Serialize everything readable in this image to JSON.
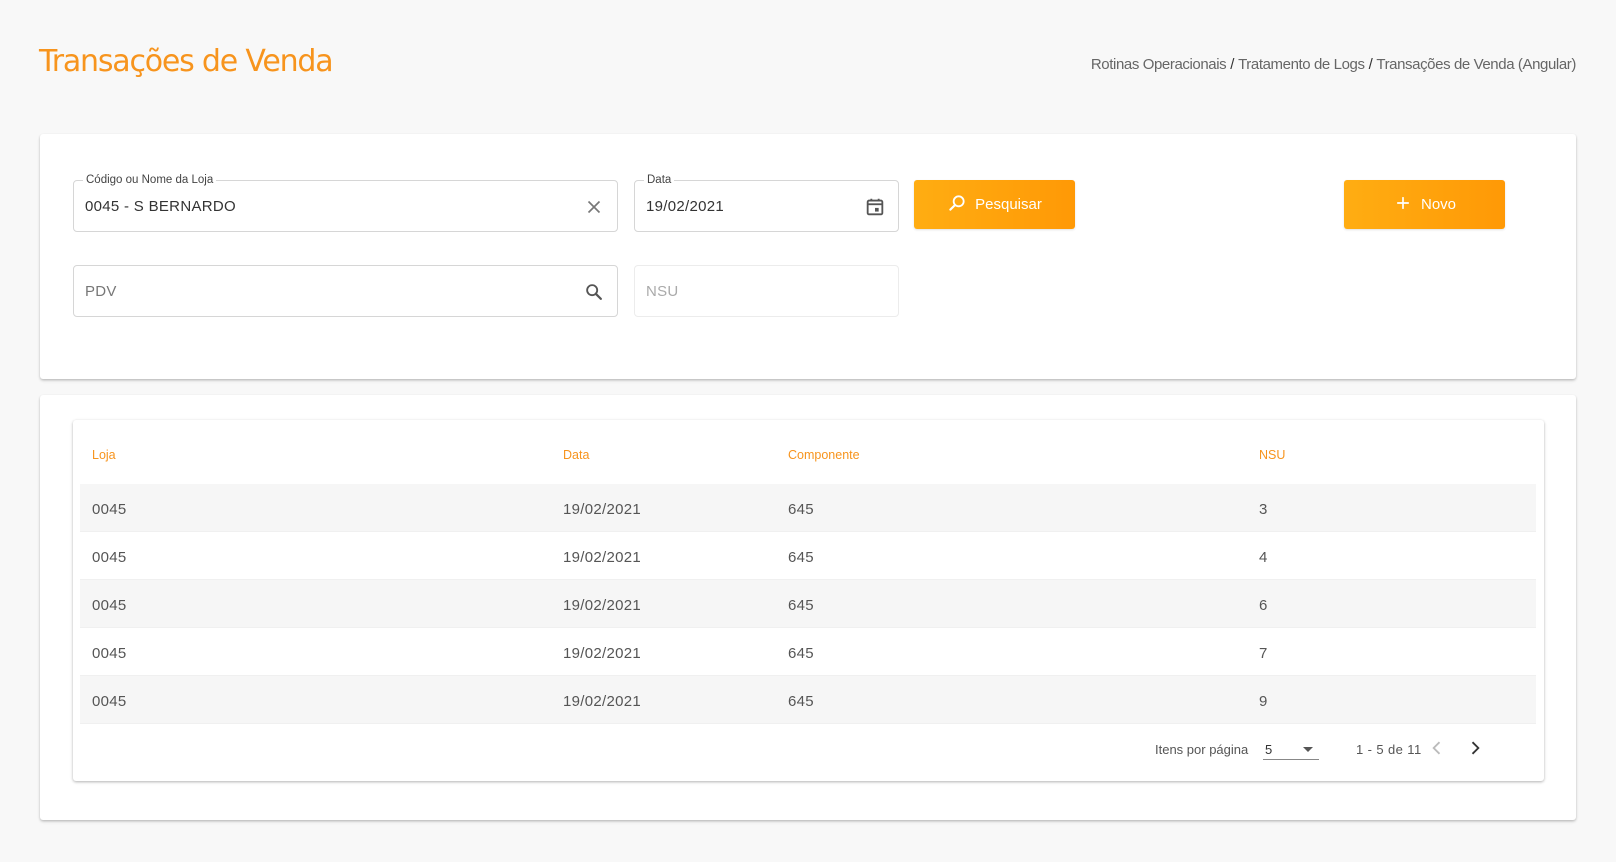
{
  "page": {
    "title": "Transações de Venda",
    "breadcrumb": [
      "Rotinas Operacionais",
      "Tratamento de Logs",
      "Transações de Venda (Angular)"
    ],
    "breadcrumb_sep": "/"
  },
  "filters": {
    "store": {
      "label": "Código ou Nome da Loja",
      "value": "0045 - S BERNARDO",
      "clear_icon": "close-icon"
    },
    "date": {
      "label": "Data",
      "value": "19/02/2021",
      "icon": "calendar-icon"
    },
    "pdv": {
      "placeholder": "PDV",
      "icon": "search-icon"
    },
    "nsu": {
      "placeholder": "NSU"
    },
    "search_button": "Pesquisar",
    "new_button": "Novo"
  },
  "table": {
    "columns": [
      "Loja",
      "Data",
      "Componente",
      "NSU"
    ],
    "rows": [
      [
        "0045",
        "19/02/2021",
        "645",
        "3"
      ],
      [
        "0045",
        "19/02/2021",
        "645",
        "4"
      ],
      [
        "0045",
        "19/02/2021",
        "645",
        "6"
      ],
      [
        "0045",
        "19/02/2021",
        "645",
        "7"
      ],
      [
        "0045",
        "19/02/2021",
        "645",
        "9"
      ]
    ]
  },
  "paginator": {
    "items_per_page_label": "Itens por página",
    "items_per_page": "5",
    "range": "1 - 5 de 11"
  },
  "colors": {
    "accent": "#f7941d",
    "button_start": "#ffad12",
    "button_end": "#ff9906"
  }
}
